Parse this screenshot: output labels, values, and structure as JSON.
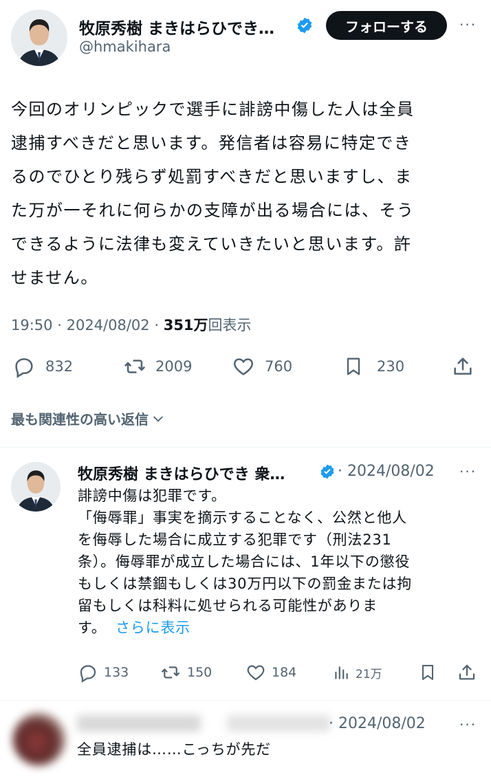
{
  "author": {
    "name": "牧原秀樹 まきはらひでき…",
    "handle": "@hmakihara",
    "follow_label": "フォローする",
    "more": "···"
  },
  "tweet": {
    "lines": [
      "今回のオリンピックで選手に誹謗中傷した人は全員",
      "逮捕すべきだと思います。発信者は容易に特定でき",
      "るのでひとり残らず処罰すべきだと思いますし、ま",
      "た万が一それに何らかの支障が出る場合には、そう",
      "できるように法律も変えていきたいと思います。許",
      "せません。"
    ],
    "time": "19:50",
    "sep": "·",
    "date": "2024/08/02",
    "views": "351万",
    "views_label": "回表示",
    "replies": "832",
    "reposts": "2009",
    "likes": "760",
    "bookmarks": "230"
  },
  "sort_label": "最も関連性の高い返信",
  "reply1": {
    "name": "牧原秀樹 まきはらひでき 衆…",
    "date": "· 2024/08/02",
    "more": "···",
    "lines": [
      "誹謗中傷は犯罪です。",
      "「侮辱罪」事実を摘示することなく、公然と他人",
      "を侮辱した場合に成立する犯罪です（刑法231",
      "条）。侮辱罪が成立した場合には、1年以下の懲役",
      "もしくは禁錮もしくは30万円以下の罰金または拘",
      "留もしくは科料に処せられる可能性がありま"
    ],
    "last_line": "す。",
    "show_more": "さらに表示",
    "replies": "133",
    "reposts": "150",
    "likes": "184",
    "views": "21万"
  },
  "reply2": {
    "date": "· 2024/08/02",
    "more": "···",
    "text": "全員逮捕は……こっちが先だ"
  },
  "colors": {
    "text": "#0f1419",
    "muted": "#536471",
    "link": "#1d9bf0",
    "verified": "#1d9bf0",
    "divider": "#eff3f4"
  }
}
